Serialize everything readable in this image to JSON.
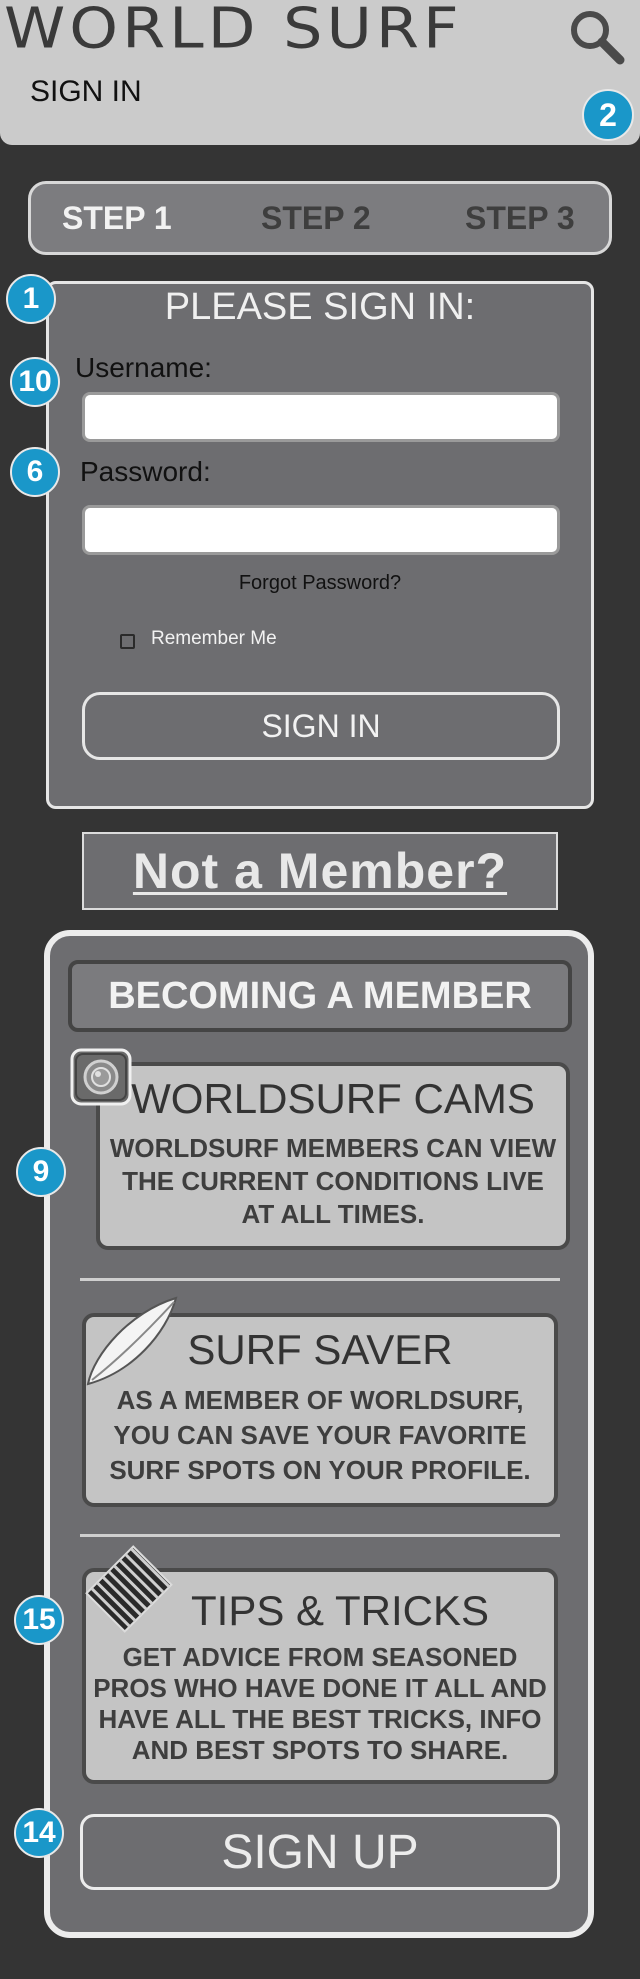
{
  "header": {
    "brand": "WORLD SURF",
    "subtitle": "SIGN IN"
  },
  "icons": {
    "search": "search-icon",
    "cam": "camera-icon",
    "surfboard": "surfboard-icon",
    "wax": "surf-wax-icon"
  },
  "badges": {
    "search": "2",
    "sign_in_panel": "1",
    "username": "10",
    "password": "6",
    "cams": "9",
    "tips": "15",
    "sign_up": "14"
  },
  "steps": [
    "STEP 1",
    "STEP 2",
    "STEP 3"
  ],
  "sign_in": {
    "title": "PLEASE SIGN IN:",
    "username_label": "Username:",
    "username_value": "",
    "password_label": "Password:",
    "password_value": "",
    "forgot": "Forgot Password?",
    "remember": "Remember Me",
    "button": "SIGN IN"
  },
  "not_member": "Not a Member?",
  "membership": {
    "title": "BECOMING A MEMBER",
    "features": [
      {
        "title": "WORLDSURF CAMS",
        "body": "WORLDSURF MEMBERS CAN VIEW THE CURRENT CONDITIONS LIVE AT ALL TIMES."
      },
      {
        "title": "SURF SAVER",
        "body": "AS A MEMBER OF WORLDSURF, YOU CAN SAVE YOUR FAVORITE SURF SPOTS ON YOUR PROFILE."
      },
      {
        "title": "TIPS & TRICKS",
        "body": "GET ADVICE FROM SEASONED PROS WHO HAVE DONE IT ALL AND HAVE ALL THE BEST TRICKS, INFO AND BEST SPOTS TO SHARE."
      }
    ],
    "signup_button": "SIGN UP"
  },
  "colors": {
    "background": "#343434",
    "header": "#cbcbcb",
    "panel": "#6d6d70",
    "badge": "#1a97c9",
    "card": "#c4c4c4"
  }
}
